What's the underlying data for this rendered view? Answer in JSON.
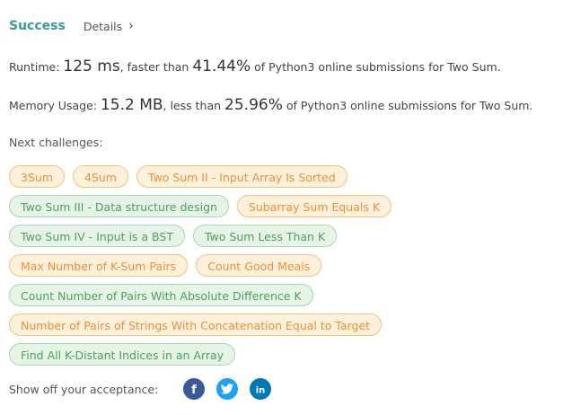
{
  "header": {
    "status": "Success",
    "details_label": "Details",
    "details_icon": "chevron-right-icon"
  },
  "runtime": {
    "label": "Runtime:",
    "value": "125 ms",
    "compare": ", faster than",
    "percent": "41.44%",
    "suffix": "of Python3 online submissions for Two Sum."
  },
  "memory": {
    "label": "Memory Usage:",
    "value": "15.2 MB",
    "compare": ", less than",
    "percent": "25.96%",
    "suffix": "of Python3 online submissions for Two Sum."
  },
  "next_challenges": {
    "label": "Next challenges:",
    "items": [
      {
        "label": "3Sum",
        "difficulty": "medium"
      },
      {
        "label": "4Sum",
        "difficulty": "medium"
      },
      {
        "label": "Two Sum II - Input Array Is Sorted",
        "difficulty": "medium"
      },
      {
        "label": "Two Sum III - Data structure design",
        "difficulty": "easy"
      },
      {
        "label": "Subarray Sum Equals K",
        "difficulty": "medium"
      },
      {
        "label": "Two Sum IV - Input is a BST",
        "difficulty": "easy"
      },
      {
        "label": "Two Sum Less Than K",
        "difficulty": "easy"
      },
      {
        "label": "Max Number of K-Sum Pairs",
        "difficulty": "medium"
      },
      {
        "label": "Count Good Meals",
        "difficulty": "medium"
      },
      {
        "label": "Count Number of Pairs With Absolute Difference K",
        "difficulty": "easy"
      },
      {
        "label": "Number of Pairs of Strings With Concatenation Equal to Target",
        "difficulty": "medium"
      },
      {
        "label": "Find All K-Distant Indices in an Array",
        "difficulty": "easy"
      }
    ]
  },
  "share": {
    "label": "Show off your acceptance:",
    "icons": [
      {
        "name": "facebook-icon",
        "color": "#3b5998"
      },
      {
        "name": "twitter-icon",
        "color": "#1da1f2"
      },
      {
        "name": "linkedin-icon",
        "color": "#0077b5"
      }
    ]
  },
  "colors": {
    "success": "#3a9b9b",
    "medium_chip": "#e8913a",
    "easy_chip": "#4fa15a"
  }
}
